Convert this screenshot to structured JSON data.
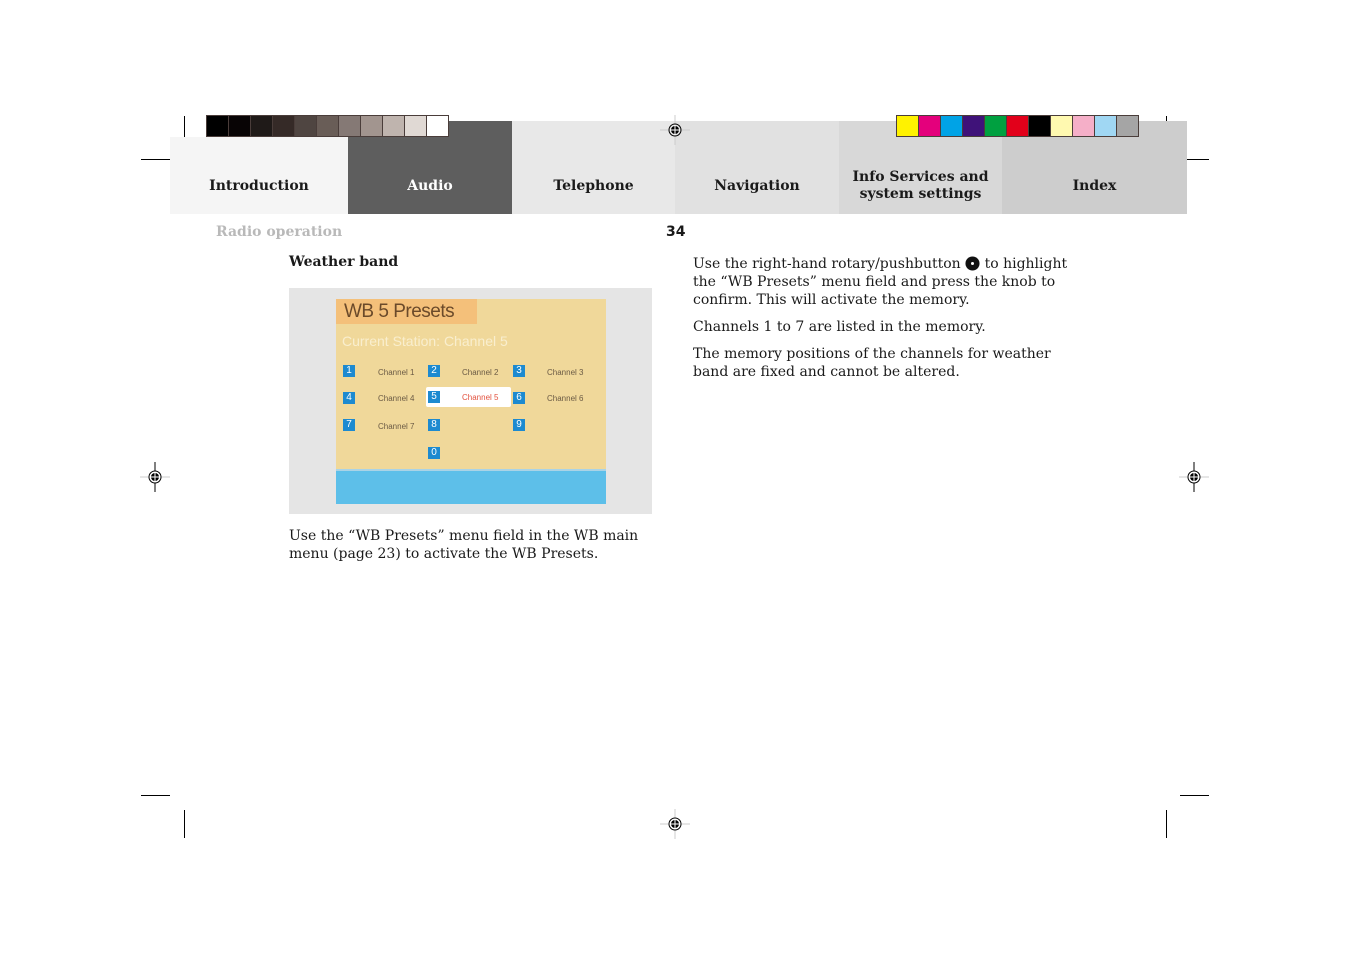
{
  "tabs": [
    {
      "label": "Introduction"
    },
    {
      "label": "Audio",
      "active": true
    },
    {
      "label": "Telephone"
    },
    {
      "label": "Navigation"
    },
    {
      "label": "Info Services and system settings",
      "line1": "Info Services and",
      "line2": "system settings"
    },
    {
      "label": "Index"
    }
  ],
  "colors": {
    "gray_swatches": [
      "#000000",
      "#080405",
      "#1f1a18",
      "#352a27",
      "#4f4541",
      "#695d57",
      "#857975",
      "#a2958f",
      "#bfb4ae",
      "#e0d9d4",
      "#ffffff"
    ],
    "color_swatches": [
      "#fff200",
      "#e4007c",
      "#00a3e6",
      "#3f1279",
      "#00a040",
      "#e2001a",
      "#000000",
      "#fff9b0",
      "#f5afc8",
      "#a0d7f3",
      "#a5a5a5"
    ],
    "active_tab": "#5e5e5e"
  },
  "header": {
    "section": "Radio operation",
    "page_number": "34"
  },
  "left": {
    "heading": "Weather band",
    "screen": {
      "title": "WB 5 Presets",
      "subtitle": "Current Station:  Channel 5",
      "presets": [
        {
          "key": "1",
          "label": "Channel 1"
        },
        {
          "key": "2",
          "label": "Channel 2"
        },
        {
          "key": "3",
          "label": "Channel 3"
        },
        {
          "key": "4",
          "label": "Channel 4"
        },
        {
          "key": "5",
          "label": "Channel 5",
          "selected": true
        },
        {
          "key": "6",
          "label": "Channel 6"
        },
        {
          "key": "7",
          "label": "Channel 7"
        },
        {
          "key": "8",
          "label": ""
        },
        {
          "key": "9",
          "label": ""
        },
        {
          "key": "0",
          "label": ""
        }
      ]
    },
    "caption": "Use the “WB Presets” menu field in the WB main menu (page 23) to activate the WB Presets."
  },
  "right": {
    "p1_before": "Use the right-hand rotary/pushbutton",
    "p1_icon": "rotary-knob-icon",
    "p1_after": "to highlight the “WB Presets” menu field and press the knob to confirm. This  will activate the memory.",
    "p2": "Channels 1 to 7 are listed in the memory.",
    "p3": "The memory positions of the channels for weather band are fixed and cannot be altered."
  }
}
